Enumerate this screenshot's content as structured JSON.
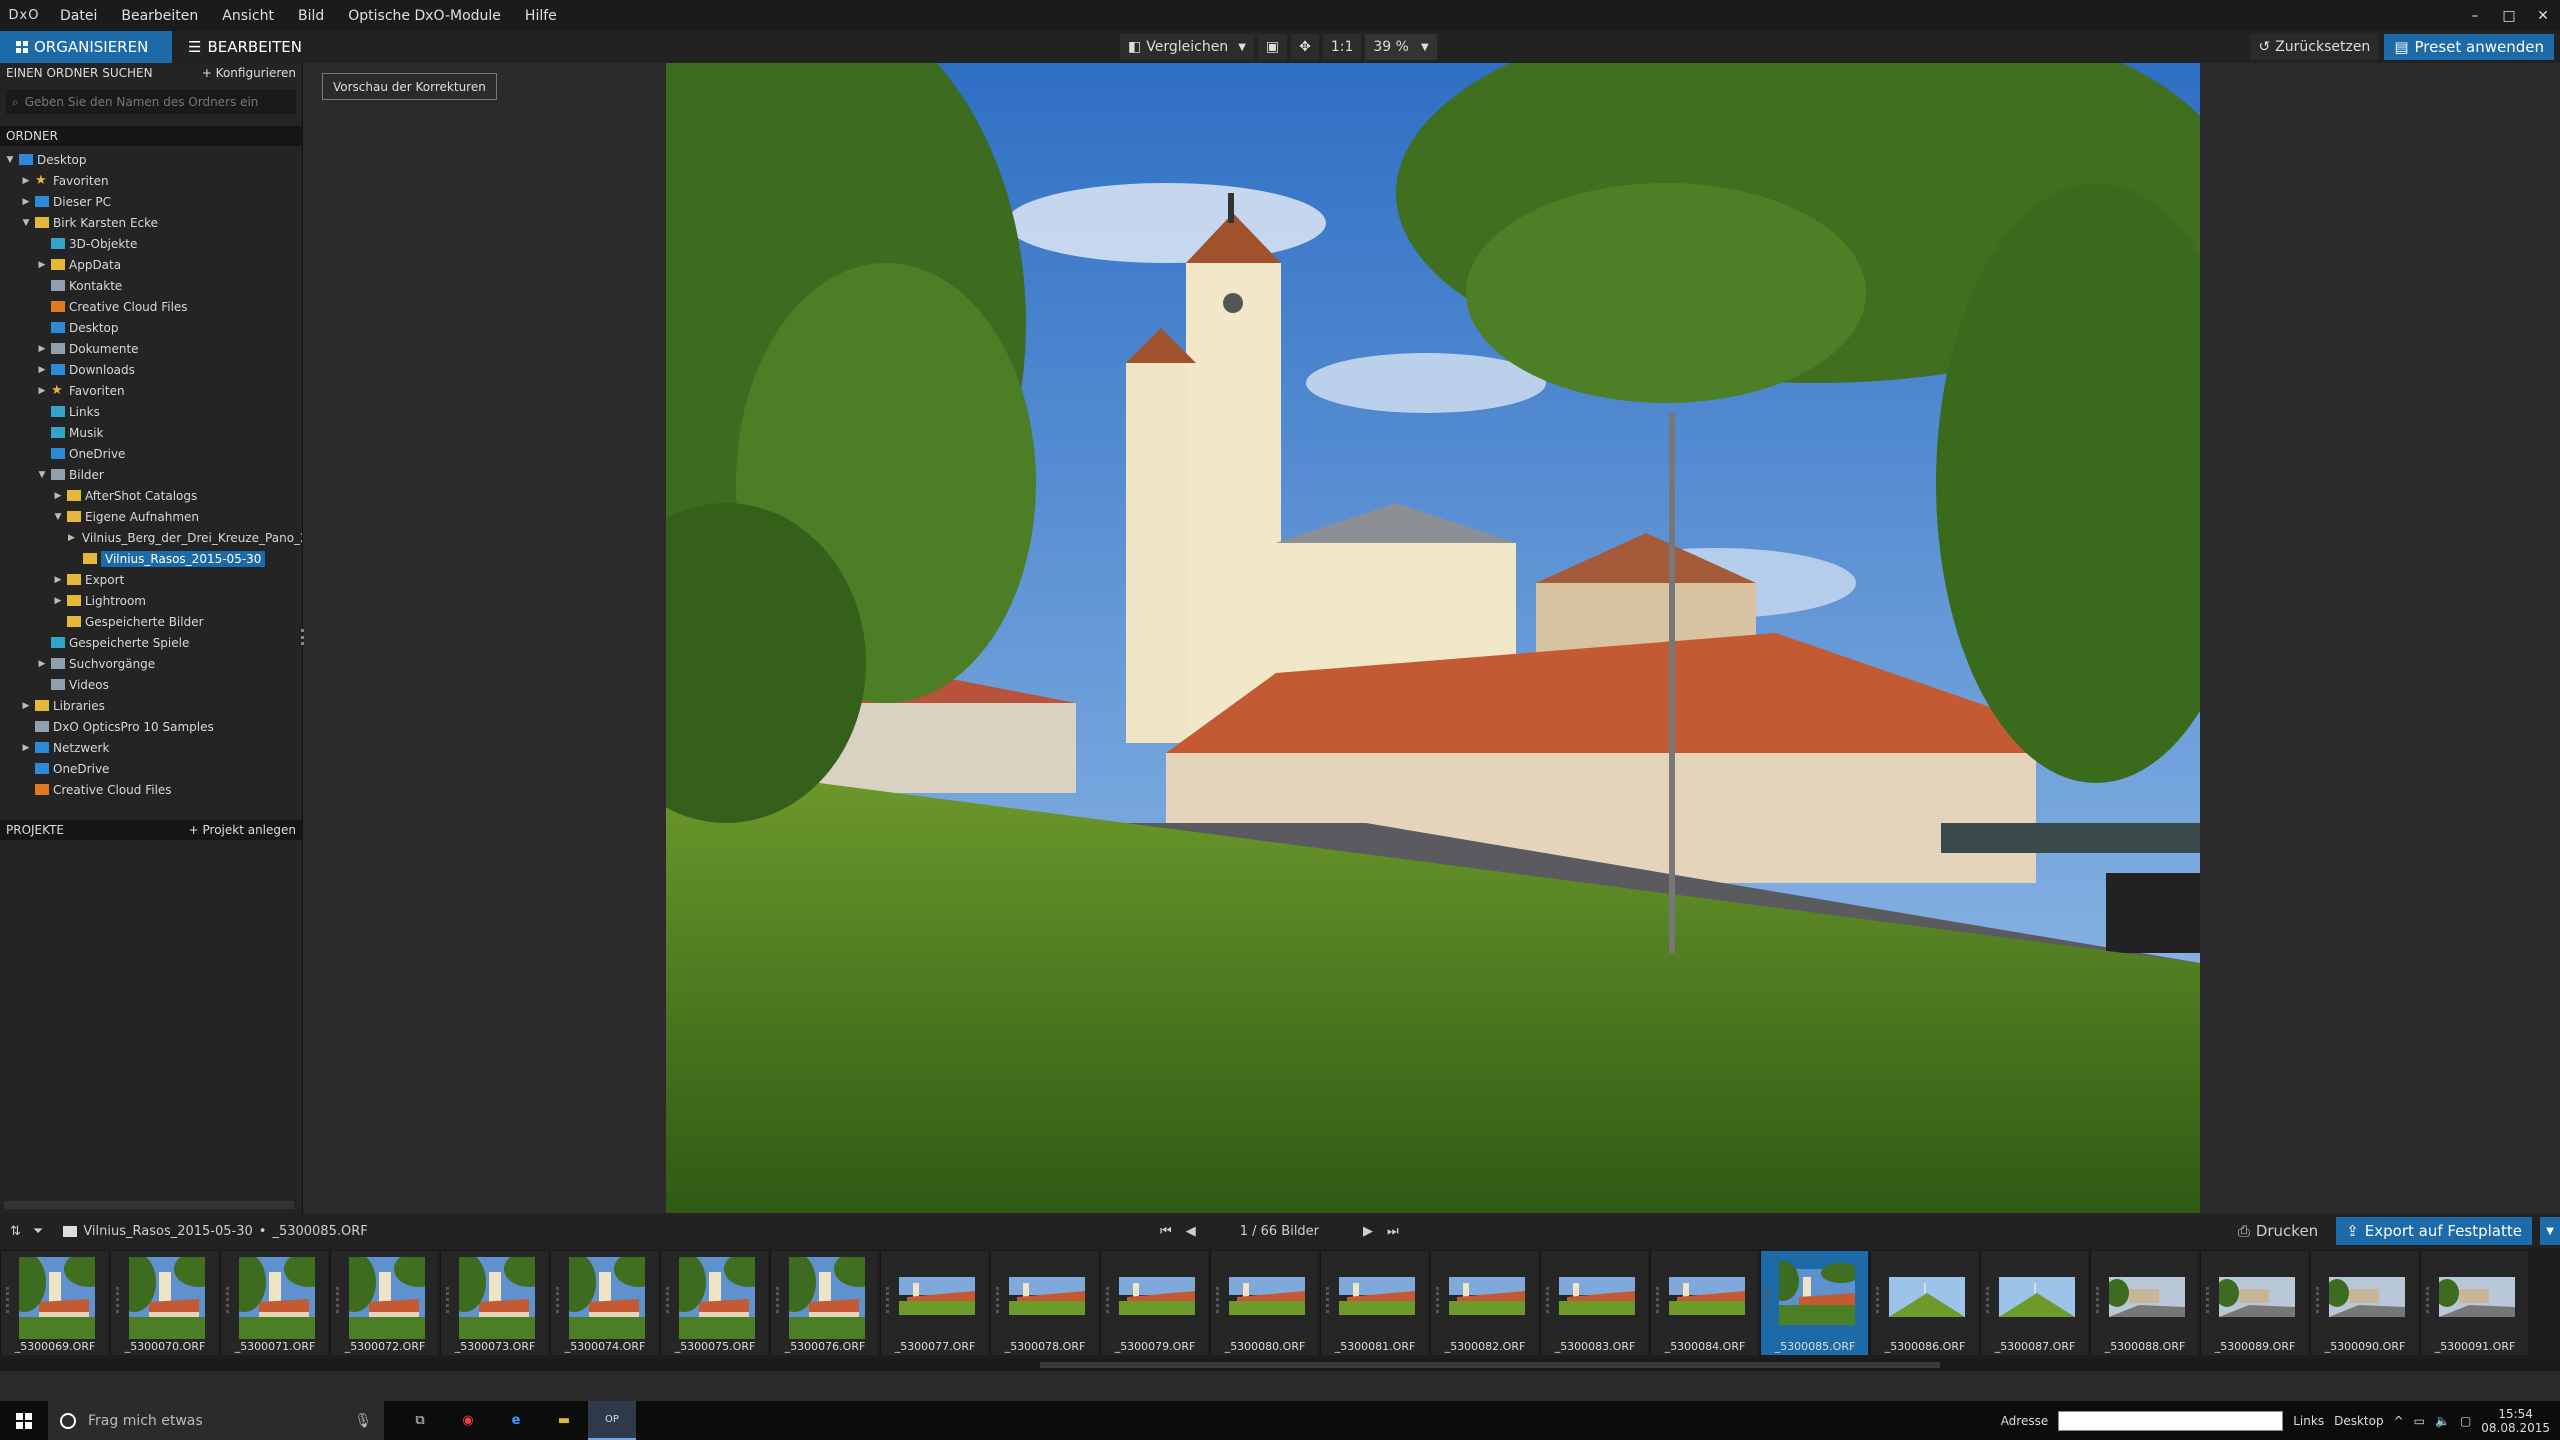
{
  "menubar": {
    "logo": "DxO",
    "items": [
      "Datei",
      "Bearbeiten",
      "Ansicht",
      "Bild",
      "Optische DxO-Module",
      "Hilfe"
    ],
    "window_controls": [
      "–",
      "□",
      "✕"
    ]
  },
  "toolbar": {
    "organize_label": "ORGANISIEREN",
    "edit_label": "BEARBEITEN",
    "compare_label": "Vergleichen",
    "one_to_one": "1:1",
    "zoom_value": "39 %",
    "reset_label": "Zurücksetzen",
    "preset_label": "Preset anwenden"
  },
  "left_panel": {
    "folder_search_title": "EINEN ORDNER SUCHEN",
    "configure_label": "+ Konfigurieren",
    "search_placeholder": "Geben Sie den Namen des Ordners ein",
    "folders_title": "ORDNER",
    "tree": [
      {
        "label": "Desktop",
        "arrow": "▼",
        "icon": "blue",
        "indent": 0
      },
      {
        "label": "Favoriten",
        "arrow": "▶",
        "icon": "star",
        "indent": 1
      },
      {
        "label": "Dieser PC",
        "arrow": "▶",
        "icon": "blue",
        "indent": 1
      },
      {
        "label": "Birk Karsten Ecke",
        "arrow": "▼",
        "icon": "yellow",
        "indent": 1
      },
      {
        "label": "3D-Objekte",
        "arrow": "",
        "icon": "teal",
        "indent": 2
      },
      {
        "label": "AppData",
        "arrow": "▶",
        "icon": "yellow",
        "indent": 2
      },
      {
        "label": "Kontakte",
        "arrow": "",
        "icon": "grey",
        "indent": 2
      },
      {
        "label": "Creative Cloud Files",
        "arrow": "",
        "icon": "orange",
        "indent": 2
      },
      {
        "label": "Desktop",
        "arrow": "",
        "icon": "blue",
        "indent": 2
      },
      {
        "label": "Dokumente",
        "arrow": "▶",
        "icon": "grey",
        "indent": 2
      },
      {
        "label": "Downloads",
        "arrow": "▶",
        "icon": "blue",
        "indent": 2
      },
      {
        "label": "Favoriten",
        "arrow": "▶",
        "icon": "star",
        "indent": 2
      },
      {
        "label": "Links",
        "arrow": "",
        "icon": "teal",
        "indent": 2
      },
      {
        "label": "Musik",
        "arrow": "",
        "icon": "teal",
        "indent": 2
      },
      {
        "label": "OneDrive",
        "arrow": "",
        "icon": "blue",
        "indent": 2
      },
      {
        "label": "Bilder",
        "arrow": "▼",
        "icon": "grey",
        "indent": 2
      },
      {
        "label": "AfterShot Catalogs",
        "arrow": "▶",
        "icon": "yellow",
        "indent": 3
      },
      {
        "label": "Eigene Aufnahmen",
        "arrow": "▼",
        "icon": "yellow",
        "indent": 3
      },
      {
        "label": "Vilnius_Berg_der_Drei_Kreuze_Pano_2(",
        "arrow": "▶",
        "icon": "yellow",
        "indent": 4
      },
      {
        "label": "Vilnius_Rasos_2015-05-30",
        "arrow": "",
        "icon": "yellow",
        "indent": 4,
        "selected": true
      },
      {
        "label": "Export",
        "arrow": "▶",
        "icon": "yellow",
        "indent": 3
      },
      {
        "label": "Lightroom",
        "arrow": "▶",
        "icon": "yellow",
        "indent": 3
      },
      {
        "label": "Gespeicherte Bilder",
        "arrow": "",
        "icon": "yellow",
        "indent": 3
      },
      {
        "label": "Gespeicherte Spiele",
        "arrow": "",
        "icon": "teal",
        "indent": 2
      },
      {
        "label": "Suchvorgänge",
        "arrow": "▶",
        "icon": "grey",
        "indent": 2
      },
      {
        "label": "Videos",
        "arrow": "",
        "icon": "grey",
        "indent": 2
      },
      {
        "label": "Libraries",
        "arrow": "▶",
        "icon": "yellow",
        "indent": 1
      },
      {
        "label": "DxO OpticsPro 10 Samples",
        "arrow": "",
        "icon": "grey",
        "indent": 1
      },
      {
        "label": "Netzwerk",
        "arrow": "▶",
        "icon": "blue",
        "indent": 1
      },
      {
        "label": "OneDrive",
        "arrow": "",
        "icon": "blue",
        "indent": 1
      },
      {
        "label": "Creative Cloud Files",
        "arrow": "",
        "icon": "orange",
        "indent": 1
      }
    ],
    "projects_title": "PROJEKTE",
    "create_project_label": "+ Projekt anlegen"
  },
  "viewer": {
    "preview_corrections_label": "Vorschau der Korrekturen"
  },
  "filmbar": {
    "path_folder": "Vilnius_Rasos_2015-05-30",
    "path_sep": "•",
    "path_file": "_5300085.ORF",
    "counter": "1 / 66  Bilder",
    "print_label": "Drucken",
    "export_label": "Export auf Festplatte"
  },
  "thumbnails": [
    {
      "name": "_5300069.ORF",
      "kind": "portrait"
    },
    {
      "name": "_5300070.ORF",
      "kind": "portrait"
    },
    {
      "name": "_5300071.ORF",
      "kind": "portrait"
    },
    {
      "name": "_5300072.ORF",
      "kind": "portrait"
    },
    {
      "name": "_5300073.ORF",
      "kind": "portrait"
    },
    {
      "name": "_5300074.ORF",
      "kind": "portrait"
    },
    {
      "name": "_5300075.ORF",
      "kind": "portrait"
    },
    {
      "name": "_5300076.ORF",
      "kind": "portrait"
    },
    {
      "name": "_5300077.ORF",
      "kind": "landscape"
    },
    {
      "name": "_5300078.ORF",
      "kind": "landscape"
    },
    {
      "name": "_5300079.ORF",
      "kind": "landscape"
    },
    {
      "name": "_5300080.ORF",
      "kind": "landscape"
    },
    {
      "name": "_5300081.ORF",
      "kind": "landscape"
    },
    {
      "name": "_5300082.ORF",
      "kind": "landscape"
    },
    {
      "name": "_5300083.ORF",
      "kind": "landscape"
    },
    {
      "name": "_5300084.ORF",
      "kind": "landscape"
    },
    {
      "name": "_5300085.ORF",
      "kind": "square",
      "selected": true
    },
    {
      "name": "_5300086.ORF",
      "kind": "hill"
    },
    {
      "name": "_5300087.ORF",
      "kind": "hill"
    },
    {
      "name": "_5300088.ORF",
      "kind": "road"
    },
    {
      "name": "_5300089.ORF",
      "kind": "road"
    },
    {
      "name": "_5300090.ORF",
      "kind": "road"
    },
    {
      "name": "_5300091.ORF",
      "kind": "road"
    }
  ],
  "taskbar": {
    "search_placeholder": "Frag mich etwas",
    "address_label": "Adresse",
    "links_label": "Links",
    "desktop_label": "Desktop",
    "time": "15:54",
    "date": "08.08.2015"
  }
}
